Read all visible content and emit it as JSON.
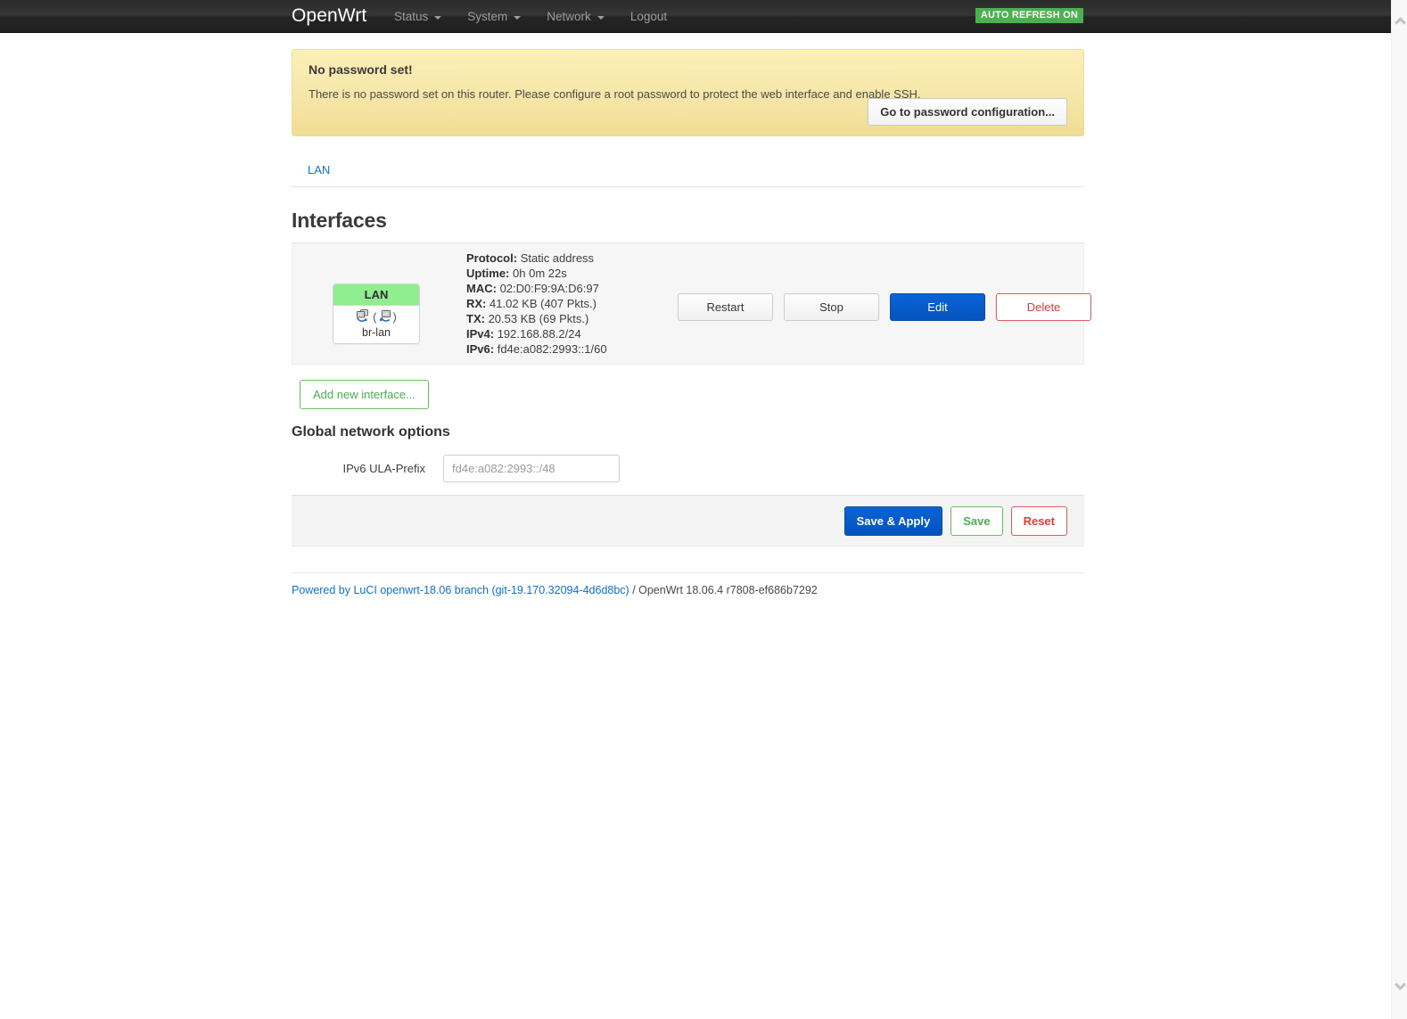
{
  "header": {
    "brand": "OpenWrt",
    "nav": [
      {
        "label": "Status",
        "has_caret": true
      },
      {
        "label": "System",
        "has_caret": true
      },
      {
        "label": "Network",
        "has_caret": true
      },
      {
        "label": "Logout",
        "has_caret": false
      }
    ],
    "refresh_badge": "AUTO REFRESH ON",
    "refresh_badge_color": "#4CAF50"
  },
  "notice": {
    "title": "No password set!",
    "text": "There is no password set on this router. Please configure a root password to protect the web interface and enable SSH.",
    "button": "Go to password configuration..."
  },
  "tabs": [
    {
      "label": "LAN",
      "active": true
    }
  ],
  "main": {
    "page_title": "Interfaces",
    "interface": {
      "badge_name": "LAN",
      "device_name": "br-lan",
      "badge_color": "#90ee90",
      "icons": [
        "network-device-icon",
        "network-device-icon"
      ],
      "details": [
        {
          "label": "Protocol:",
          "value": "Static address"
        },
        {
          "label": "Uptime:",
          "value": "0h 0m 22s"
        },
        {
          "label": "MAC:",
          "value": "02:D0:F9:9A:D6:97"
        },
        {
          "label": "RX:",
          "value": "41.02 KB (407 Pkts.)"
        },
        {
          "label": "TX:",
          "value": "20.53 KB (69 Pkts.)"
        },
        {
          "label": "IPv4:",
          "value": "192.168.88.2/24"
        },
        {
          "label": "IPv6:",
          "value": "fd4e:a082:2993::1/60"
        }
      ],
      "actions": [
        {
          "label": "Restart",
          "style": "default"
        },
        {
          "label": "Stop",
          "style": "default"
        },
        {
          "label": "Edit",
          "style": "primary"
        },
        {
          "label": "Delete",
          "style": "danger"
        }
      ]
    },
    "add_interface_button": "Add new interface...",
    "global_options": {
      "title": "Global network options",
      "ula_label": "IPv6 ULA-Prefix",
      "ula_value": "",
      "ula_placeholder": "fd4e:a082:2993::/48"
    },
    "save_bar": {
      "save_apply": "Save & Apply",
      "save": "Save",
      "reset": "Reset"
    }
  },
  "footer": {
    "link": "Powered by LuCI openwrt-18.06 branch (git-19.170.32094-4d6d8bc)",
    "rest": " / OpenWrt 18.06.4 r7808-ef686b7292"
  }
}
